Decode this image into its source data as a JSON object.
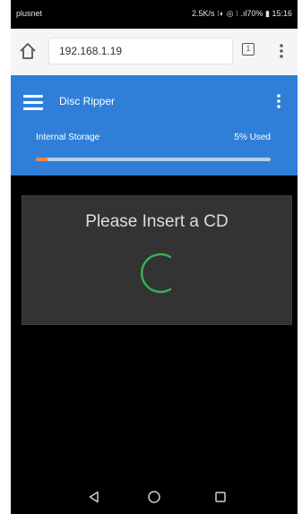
{
  "status_bar": {
    "carrier": "plusnet",
    "right_text": "2.5K/s ⁝◐ ◎ ⁝ .ıl70% ▮ 15:16"
  },
  "browser": {
    "url": "192.168.1.19",
    "tab_count": "1"
  },
  "app_bar": {
    "title": "Disc Ripper",
    "storage_label": "Internal Storage",
    "storage_used_text": "5% Used",
    "storage_used_fraction": 0.05,
    "color": "#2f7fd8",
    "progress_color": "#e6894a"
  },
  "main": {
    "message": "Please Insert a CD",
    "spinner_color": "#35b35a"
  },
  "icons": {
    "home": "home-icon",
    "tabs": "tabs-icon",
    "browser_menu": "more-vert-icon",
    "hamburger": "hamburger-icon",
    "app_menu": "more-vert-icon",
    "spinner": "loading-spinner-icon",
    "nav_back": "back-triangle-icon",
    "nav_home": "home-circle-icon",
    "nav_recents": "recents-square-icon"
  }
}
